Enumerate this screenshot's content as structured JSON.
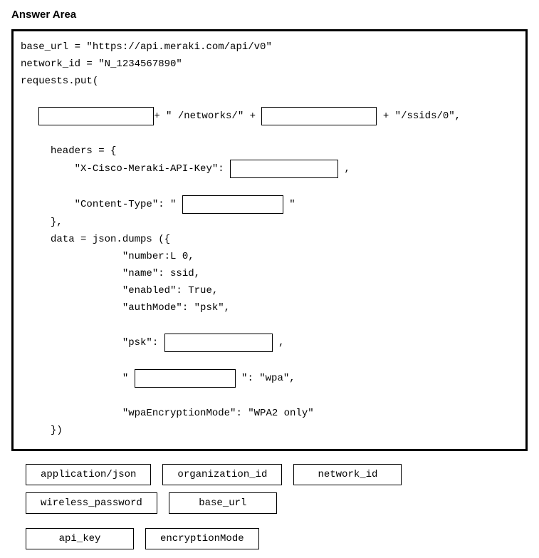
{
  "title": "Answer Area",
  "code": {
    "l1": "base_url = \"https://api.meraki.com/api/v0\"",
    "l2": "network_id = \"N_1234567890\"",
    "l3": "requests.put(",
    "l4a": "   ",
    "l4b": "+ \" /networks/\" + ",
    "l4c": " + \"/ssids/0\",",
    "l5": "     headers = {",
    "l6a": "         \"X-Cisco-Meraki-API-Key\": ",
    "l6b": " ,",
    "l7a": "         \"Content-Type\": \" ",
    "l7b": " \"",
    "l8": "     },",
    "l9": "     data = json.dumps ({",
    "l10": "                 \"number:L 0,",
    "l11": "                 \"name\": ssid,",
    "l12": "                 \"enabled\": True,",
    "l13": "                 \"authMode\": \"psk\",",
    "l14a": "                 \"psk\": ",
    "l14b": " ,",
    "l15a": "                 \" ",
    "l15b": " \": \"wpa\",",
    "l16": "                 \"wpaEncryptionMode\": \"WPA2 only\"",
    "l17": "     })"
  },
  "options": [
    "application/json",
    "organization_id",
    "network_id",
    "wireless_password",
    "base_url",
    "api_key",
    "encryptionMode"
  ]
}
